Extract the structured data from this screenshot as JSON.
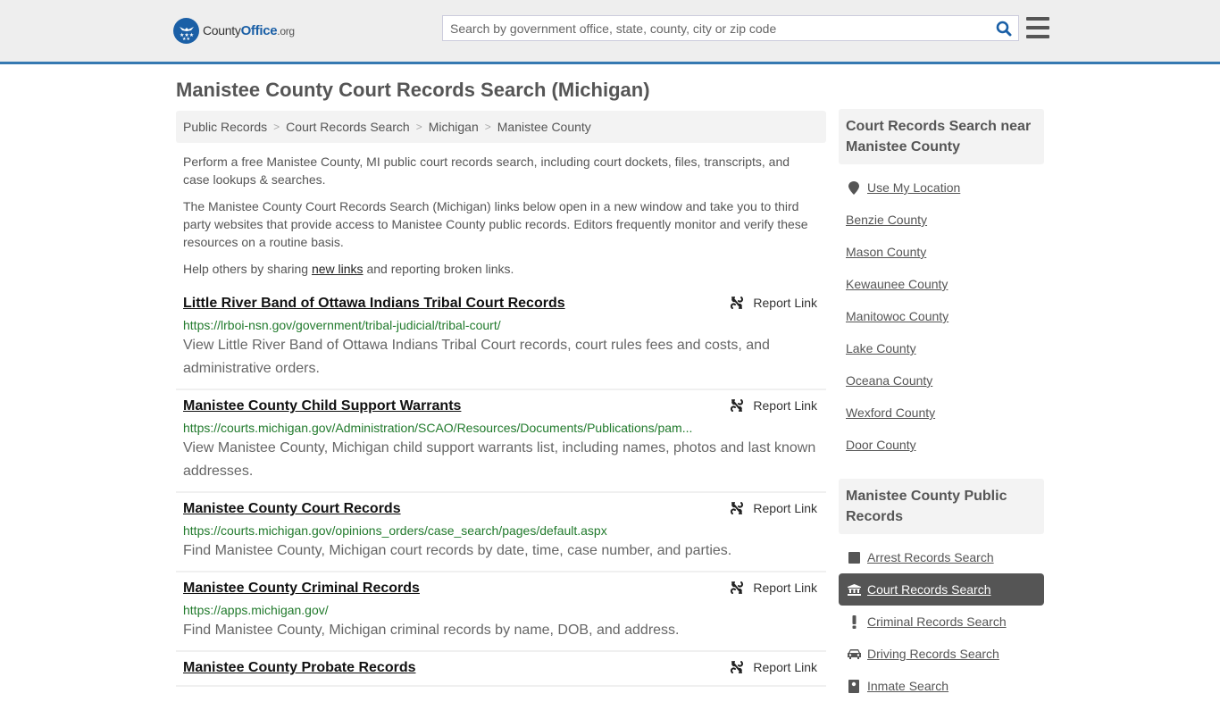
{
  "header": {
    "logo": {
      "name_part1": "County",
      "name_part2": "Office",
      "name_part3": ".org",
      "icon": "eagle-stars-badge-icon"
    },
    "search": {
      "placeholder": "Search by government office, state, county, city or zip code",
      "value": "",
      "icon": "search-icon"
    },
    "menu_icon": "hamburger-menu-icon"
  },
  "colors": {
    "brand_blue": "#1a5fa6",
    "header_border": "#3579b1",
    "url_green": "#217a2c",
    "active_bg": "#555555"
  },
  "page_title": "Manistee County Court Records Search (Michigan)",
  "breadcrumb": [
    {
      "label": "Public Records"
    },
    {
      "label": "Court Records Search"
    },
    {
      "label": "Michigan"
    },
    {
      "label": "Manistee County"
    }
  ],
  "breadcrumb_separator": ">",
  "intro": {
    "p1": "Perform a free Manistee County, MI public court records search, including court dockets, files, transcripts, and case lookups & searches.",
    "p2": "The Manistee County Court Records Search (Michigan) links below open in a new window and take you to third party websites that provide access to Manistee County public records. Editors frequently monitor and verify these resources on a routine basis.",
    "p3_before": "Help others by sharing ",
    "p3_link": "new links",
    "p3_after": " and reporting broken links."
  },
  "report_label": "Report Link",
  "results": [
    {
      "title": "Little River Band of Ottawa Indians Tribal Court Records",
      "url": "https://lrboi-nsn.gov/government/tribal-judicial/tribal-court/",
      "description": "View Little River Band of Ottawa Indians Tribal Court records, court rules fees and costs, and administrative orders."
    },
    {
      "title": "Manistee County Child Support Warrants",
      "url": "https://courts.michigan.gov/Administration/SCAO/Resources/Documents/Publications/pam...",
      "description": "View Manistee County, Michigan child support warrants list, including names, photos and last known addresses."
    },
    {
      "title": "Manistee County Court Records",
      "url": "https://courts.michigan.gov/opinions_orders/case_search/pages/default.aspx",
      "description": "Find Manistee County, Michigan court records by date, time, case number, and parties."
    },
    {
      "title": "Manistee County Criminal Records",
      "url": "https://apps.michigan.gov/",
      "description": "Find Manistee County, Michigan criminal records by name, DOB, and address."
    },
    {
      "title": "Manistee County Probate Records",
      "url": "",
      "description": ""
    }
  ],
  "sidebar": {
    "nearby": {
      "heading": "Court Records Search near Manistee County",
      "use_location": {
        "label": "Use My Location",
        "icon": "map-pin-icon"
      },
      "counties": [
        "Benzie County",
        "Mason County",
        "Kewaunee County",
        "Manitowoc County",
        "Lake County",
        "Oceana County",
        "Wexford County",
        "Door County"
      ]
    },
    "public_records": {
      "heading": "Manistee County Public Records",
      "items": [
        {
          "label": "Arrest Records Search",
          "icon": "square-icon",
          "active": false
        },
        {
          "label": "Court Records Search",
          "icon": "courthouse-icon",
          "active": true
        },
        {
          "label": "Criminal Records Search",
          "icon": "exclamation-icon",
          "active": false
        },
        {
          "label": "Driving Records Search",
          "icon": "car-icon",
          "active": false
        },
        {
          "label": "Inmate Search",
          "icon": "inmate-icon",
          "active": false
        }
      ]
    }
  }
}
